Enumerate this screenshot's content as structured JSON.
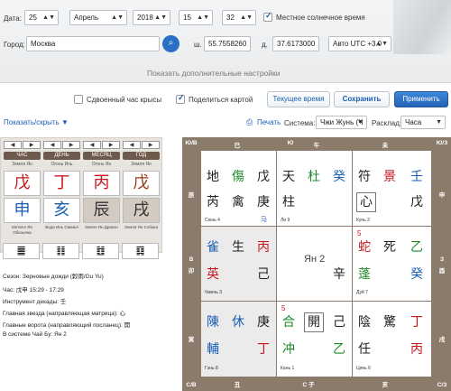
{
  "form": {
    "date_label": "Дата:",
    "day": "25",
    "month": "Апрель",
    "year": "2018",
    "hour": "15",
    "minute": "32",
    "solar_label": "Местное солнечное время",
    "city_label": "Город:",
    "city": "Москва",
    "lat_label": "ш.",
    "lat": "55.7558260",
    "lon_label": "д.",
    "lon": "37.6173000",
    "tz": "Авто UTC +3.0",
    "more_settings": "Показать дополнительные настройки",
    "double_hour": "Сдвоенный час крысы",
    "share": "Поделиться картой",
    "current_time": "Текущее время",
    "save": "Сохранить",
    "apply": "Применить"
  },
  "toolbar": {
    "toggle": "Показать/скрыть",
    "print": "Печать",
    "system_label": "Система:",
    "system": "Чжи Жунь (Ч",
    "layout_label": "Расклад:",
    "layout": "Часа"
  },
  "pillars": {
    "headers": [
      "ЧАС",
      "ДЕНЬ",
      "МЕСЯЦ",
      "ГОД"
    ],
    "stem_labels": [
      "Земля Ян",
      "Огонь Инь",
      "Огонь Ян",
      "Земля Ян"
    ],
    "stems": [
      "戊",
      "丁",
      "丙",
      "戊"
    ],
    "branches": [
      "申",
      "亥",
      "辰",
      "戌"
    ],
    "branch_captions": [
      "Металл Ян Обезьяна",
      "Вода Инь Свинья",
      "Земля Ян Дракон",
      "Земля Ян Собака"
    ],
    "hexagrams": [
      "䷀",
      "䷁",
      "䷂",
      "䷃"
    ]
  },
  "info": {
    "season": "Сезон: Зерновые дожди (穀雨/Gu Yu)",
    "hour": "Час: 戊申 15:29 - 17:29",
    "decade": "Инструмент декады: 壬",
    "star": "Главная звезда (направляющая матрица): 心",
    "gate": "Главные ворота (направляющий посланец): 開",
    "system": "В системе Чай Бу: Ян 2"
  },
  "chart": {
    "border": {
      "tl": "Ю/В",
      "tr": "Ю/З",
      "bl": "С/В",
      "br": "С/З",
      "top": [
        "巳",
        "午",
        "未"
      ],
      "bottom": [
        "丑",
        "子",
        "亥"
      ],
      "left_top": "辰",
      "left_mid": [
        "В",
        "卯"
      ],
      "left_bot": "寅",
      "right_top": "申",
      "right_mid": [
        "З",
        "酉"
      ],
      "right_bot": "戌",
      "top_dir": "Ю",
      "bottom_dir": "С"
    },
    "palaces": [
      {
        "chars": [
          "地",
          "傷",
          "戊",
          "芮",
          "禽",
          "庚"
        ],
        "cap": "Сюнь 4",
        "extra": "马"
      },
      {
        "chars": [
          "天",
          "杜",
          "癸",
          "柱",
          "",
          ""
        ],
        "cap": "Ли 9",
        "extra": ""
      },
      {
        "chars": [
          "符",
          "景",
          "壬",
          "",
          "心",
          "戊"
        ],
        "cap": "Кунь 2",
        "extra": ""
      },
      {
        "chars": [
          "雀",
          "生",
          "丙",
          "英",
          "",
          "己"
        ],
        "cap": "Чжень 3",
        "extra": ""
      },
      {
        "chars": [
          "",
          "Ян 2",
          "",
          "",
          "辛",
          ""
        ],
        "cap": "",
        "extra": ""
      },
      {
        "chars": [
          "蛇",
          "死",
          "乙",
          "蓬",
          "",
          "癸"
        ],
        "cap": "Дуй 7",
        "extra": "5"
      },
      {
        "chars": [
          "陳",
          "休",
          "庚",
          "輔",
          "",
          "丁"
        ],
        "cap": "Гэнь 8",
        "extra": ""
      },
      {
        "chars": [
          "合",
          "開",
          "己",
          "冲",
          "",
          "乙"
        ],
        "cap": "Кань 1",
        "extra": "5"
      },
      {
        "chars": [
          "陰",
          "驚",
          "丁",
          "任",
          "",
          "丙"
        ],
        "cap": "Цянь 6",
        "extra": ""
      }
    ]
  },
  "colors": {
    "accent": "#1a5fb4",
    "red": "#c8171b",
    "green": "#1d8a2a",
    "blue": "#1a5fb4",
    "frame": "#8b7b6b"
  }
}
